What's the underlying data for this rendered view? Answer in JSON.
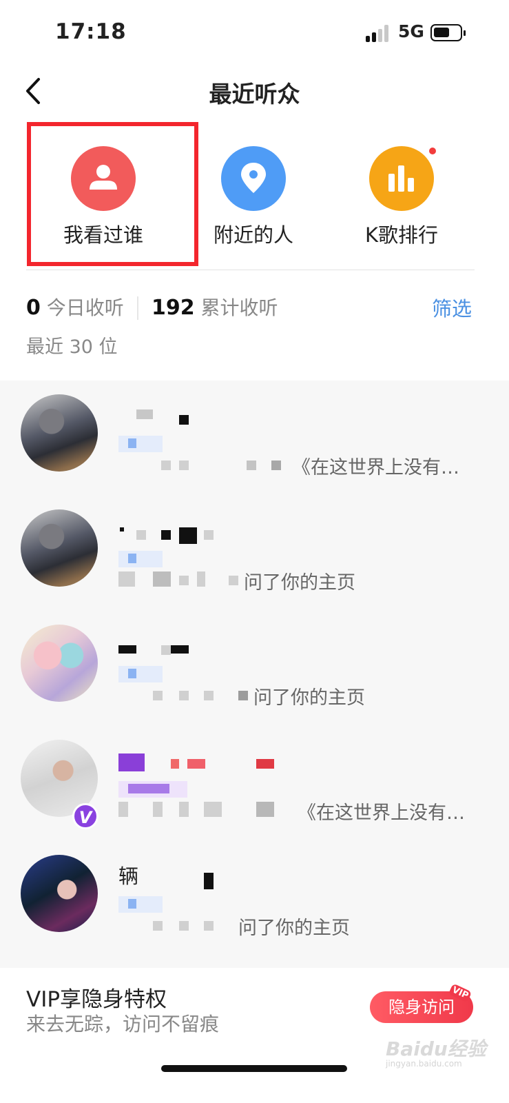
{
  "status": {
    "time": "17:18",
    "network": "5G"
  },
  "nav": {
    "title": "最近听众"
  },
  "entries": [
    {
      "label": "我看过谁",
      "color": "#f25b5b",
      "icon": "person-icon"
    },
    {
      "label": "附近的人",
      "color": "#4f9cf6",
      "icon": "location-pin-icon"
    },
    {
      "label": "K歌排行",
      "color": "#f6a516",
      "icon": "bar-chart-icon"
    }
  ],
  "stats": {
    "today_count": "0",
    "today_label": "今日收听",
    "total_count": "192",
    "total_label": "累计收听",
    "filter": "筛选",
    "recent": "最近 30 位"
  },
  "listeners": [
    {
      "desc": "《在这世界上没有…"
    },
    {
      "desc": "问了你的主页"
    },
    {
      "desc": "问了你的主页"
    },
    {
      "desc": "《在这世界上没有…",
      "badge": "V"
    },
    {
      "desc": "问了你的主页",
      "name_char": "辆"
    }
  ],
  "vip": {
    "title": "VIP享隐身特权",
    "subtitle": "来去无踪，访问不留痕",
    "button": "隐身访问",
    "button_tag": "VIP"
  },
  "watermark": {
    "logo": "Baidu经验",
    "url": "jingyan.baidu.com"
  }
}
